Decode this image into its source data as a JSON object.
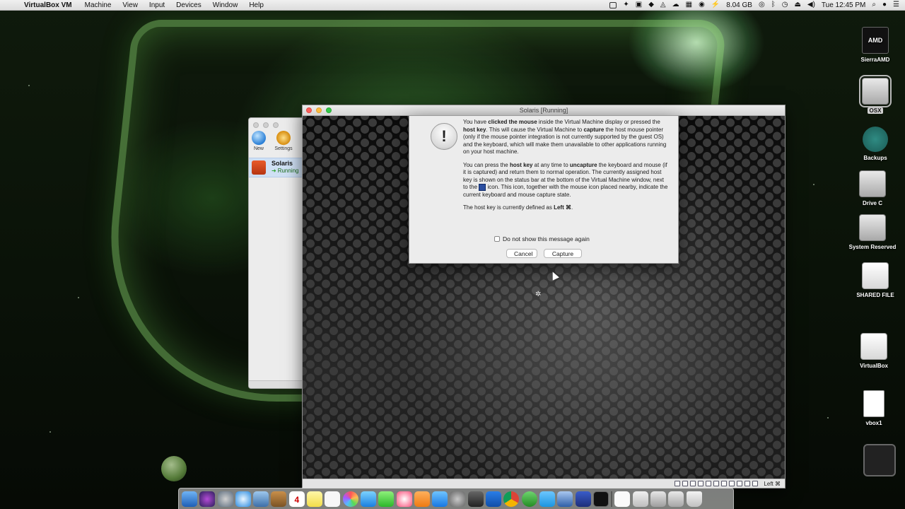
{
  "menubar": {
    "app_name": "VirtualBox VM",
    "items": [
      "Machine",
      "View",
      "Input",
      "Devices",
      "Window",
      "Help"
    ],
    "memory": "8.04 GB",
    "clock": "Tue 12:45 PM"
  },
  "manager": {
    "new_label": "New",
    "settings_label": "Settings",
    "vm_name": "Solaris",
    "vm_state": "Running"
  },
  "vm_window": {
    "title": "Solaris [Running]",
    "host_key_status": "Left ⌘"
  },
  "dialog": {
    "p1_a": "You have ",
    "p1_b": "clicked the mouse",
    "p1_c": " inside the Virtual Machine display or pressed the ",
    "p1_d": "host key",
    "p1_e": ". This will cause the Virtual Machine to ",
    "p1_f": "capture",
    "p1_g": " the host mouse pointer (only if the mouse pointer integration is not currently supported by the guest OS) and the keyboard, which will make them unavailable to other applications running on your host machine.",
    "p2_a": "You can press the ",
    "p2_b": "host key",
    "p2_c": " at any time to ",
    "p2_d": "uncapture",
    "p2_e": " the keyboard and mouse (if it is captured) and return them to normal operation. The currently assigned host key is shown on the status bar at the bottom of the Virtual Machine window, next to the ",
    "p2_f": " icon. This icon, together with the mouse icon placed nearby, indicate the current keyboard and mouse capture state.",
    "p3_a": "The host key is currently defined as ",
    "p3_b": "Left ⌘",
    "p3_c": ".",
    "checkbox_label": "Do not show this message again",
    "cancel_label": "Cancel",
    "capture_label": "Capture"
  },
  "desktop": {
    "icons": [
      "SierraAMD",
      "OSX",
      "Backups",
      "Drive C",
      "System Reserved",
      "SHARED FILE",
      "VirtualBox",
      "vbox1"
    ],
    "amd_text": "AMD"
  },
  "dock": {
    "calendar_day": "4"
  }
}
